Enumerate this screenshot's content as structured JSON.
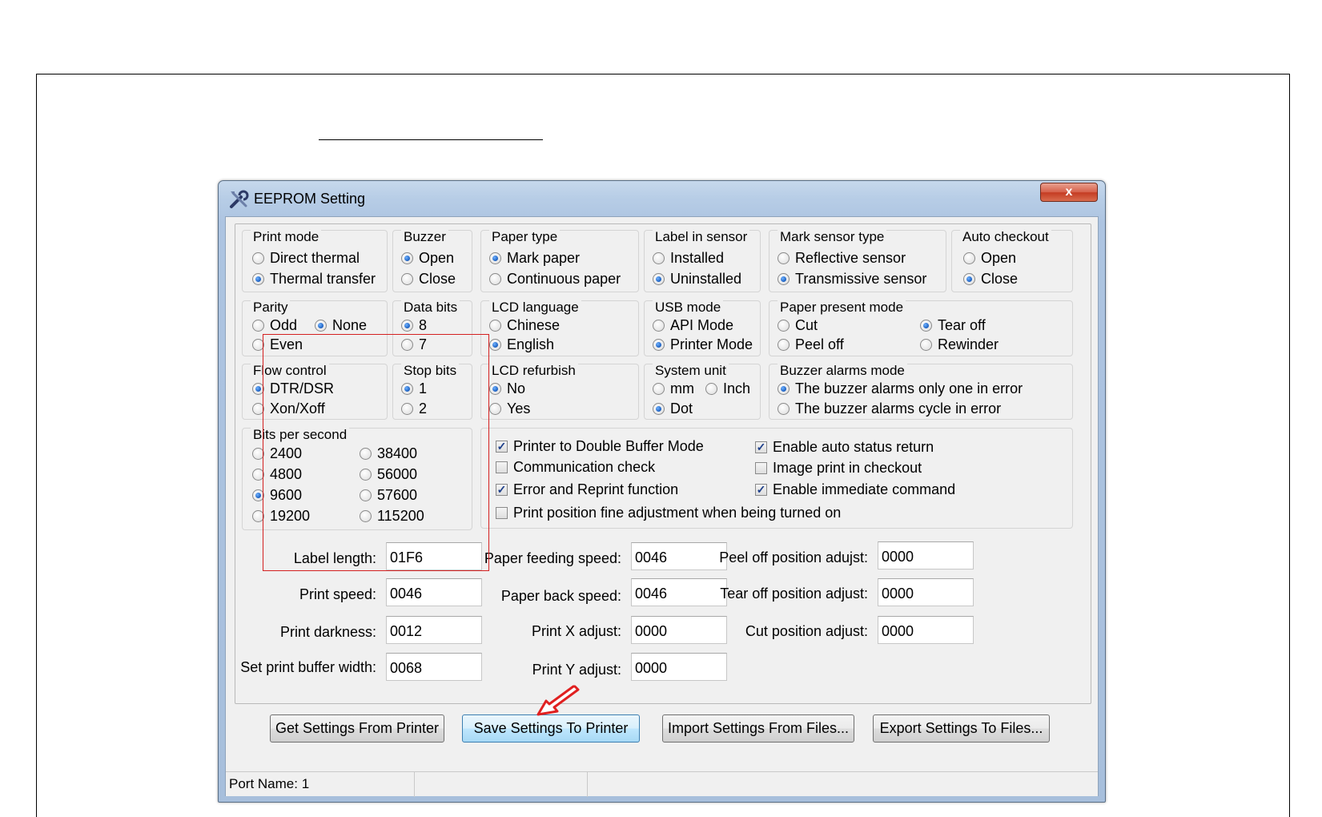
{
  "window": {
    "title": "EEPROM Setting",
    "close_glyph": "x"
  },
  "groups": {
    "print_mode": {
      "title": "Print mode",
      "options": [
        {
          "label": "Direct thermal",
          "selected": false
        },
        {
          "label": "Thermal transfer",
          "selected": true
        }
      ]
    },
    "buzzer": {
      "title": "Buzzer",
      "options": [
        {
          "label": "Open",
          "selected": true
        },
        {
          "label": "Close",
          "selected": false
        }
      ]
    },
    "paper_type": {
      "title": "Paper type",
      "options": [
        {
          "label": "Mark paper",
          "selected": true
        },
        {
          "label": "Continuous paper",
          "selected": false
        }
      ]
    },
    "label_in_sensor": {
      "title": "Label in sensor",
      "options": [
        {
          "label": "Installed",
          "selected": false
        },
        {
          "label": "Uninstalled",
          "selected": true
        }
      ]
    },
    "mark_sensor_type": {
      "title": "Mark sensor type",
      "options": [
        {
          "label": "Reflective sensor",
          "selected": false
        },
        {
          "label": "Transmissive sensor",
          "selected": true
        }
      ]
    },
    "auto_checkout": {
      "title": "Auto checkout",
      "options": [
        {
          "label": "Open",
          "selected": false
        },
        {
          "label": "Close",
          "selected": true
        }
      ]
    },
    "parity": {
      "title": "Parity",
      "options": [
        {
          "label": "Odd",
          "selected": false
        },
        {
          "label": "None",
          "selected": true
        },
        {
          "label": "Even",
          "selected": false
        }
      ]
    },
    "data_bits": {
      "title": "Data bits",
      "options": [
        {
          "label": "8",
          "selected": true
        },
        {
          "label": "7",
          "selected": false
        }
      ]
    },
    "lcd_language": {
      "title": "LCD language",
      "options": [
        {
          "label": "Chinese",
          "selected": false
        },
        {
          "label": "English",
          "selected": true
        }
      ]
    },
    "usb_mode": {
      "title": "USB mode",
      "options": [
        {
          "label": "API Mode",
          "selected": false
        },
        {
          "label": "Printer Mode",
          "selected": true
        }
      ]
    },
    "paper_present_mode": {
      "title": "Paper present mode",
      "options": [
        {
          "label": "Cut",
          "selected": false
        },
        {
          "label": "Tear off",
          "selected": true
        },
        {
          "label": "Peel off",
          "selected": false
        },
        {
          "label": "Rewinder",
          "selected": false
        }
      ]
    },
    "flow_control": {
      "title": "Flow control",
      "options": [
        {
          "label": "DTR/DSR",
          "selected": true
        },
        {
          "label": "Xon/Xoff",
          "selected": false
        }
      ]
    },
    "stop_bits": {
      "title": "Stop bits",
      "options": [
        {
          "label": "1",
          "selected": true
        },
        {
          "label": "2",
          "selected": false
        }
      ]
    },
    "lcd_refurbish": {
      "title": "LCD refurbish",
      "options": [
        {
          "label": "No",
          "selected": true
        },
        {
          "label": "Yes",
          "selected": false
        }
      ]
    },
    "system_unit": {
      "title": "System unit",
      "options": [
        {
          "label": "mm",
          "selected": false
        },
        {
          "label": "Inch",
          "selected": false
        },
        {
          "label": "Dot",
          "selected": true
        }
      ]
    },
    "buzzer_alarms_mode": {
      "title": "Buzzer alarms mode",
      "options": [
        {
          "label": "The buzzer alarms only one in error",
          "selected": true
        },
        {
          "label": "The buzzer alarms cycle in error",
          "selected": false
        }
      ]
    },
    "bits_per_second": {
      "title": "Bits per second",
      "options": [
        {
          "label": "2400",
          "selected": false
        },
        {
          "label": "4800",
          "selected": false
        },
        {
          "label": "9600",
          "selected": true
        },
        {
          "label": "19200",
          "selected": false
        },
        {
          "label": "38400",
          "selected": false
        },
        {
          "label": "56000",
          "selected": false
        },
        {
          "label": "57600",
          "selected": false
        },
        {
          "label": "115200",
          "selected": false
        }
      ]
    }
  },
  "checkboxes": [
    {
      "label": "Printer to Double Buffer Mode",
      "checked": true
    },
    {
      "label": "Communication check",
      "checked": false
    },
    {
      "label": "Error and Reprint function",
      "checked": true
    },
    {
      "label": "Print position fine adjustment when being turned on",
      "checked": false
    },
    {
      "label": "Enable auto status return",
      "checked": true
    },
    {
      "label": "Image print in checkout",
      "checked": false
    },
    {
      "label": "Enable immediate command",
      "checked": true
    }
  ],
  "fields": {
    "label_length": {
      "label": "Label length:",
      "value": "01F6"
    },
    "print_speed": {
      "label": "Print speed:",
      "value": "0046"
    },
    "print_darkness": {
      "label": "Print darkness:",
      "value": "0012"
    },
    "print_buffer_width": {
      "label": "Set print buffer width:",
      "value": "0068"
    },
    "paper_feeding_speed": {
      "label": "Paper feeding speed:",
      "value": "0046"
    },
    "paper_back_speed": {
      "label": "Paper back speed:",
      "value": "0046"
    },
    "print_x_adjust": {
      "label": "Print X adjust:",
      "value": "0000"
    },
    "print_y_adjust": {
      "label": "Print Y adjust:",
      "value": "0000"
    },
    "peel_off_adjust": {
      "label": "Peel off position adujst:",
      "value": "0000"
    },
    "tear_off_adjust": {
      "label": "Tear off position adjust:",
      "value": "0000"
    },
    "cut_adjust": {
      "label": "Cut position adjust:",
      "value": "0000"
    }
  },
  "buttons": {
    "get": "Get Settings From Printer",
    "save": "Save Settings To Printer",
    "import": "Import Settings From Files...",
    "export": "Export Settings To Files..."
  },
  "status": {
    "port": "Port Name: 1"
  },
  "colors": {
    "highlight_box": "#d42020",
    "annotation_arrow": "#e02020"
  }
}
